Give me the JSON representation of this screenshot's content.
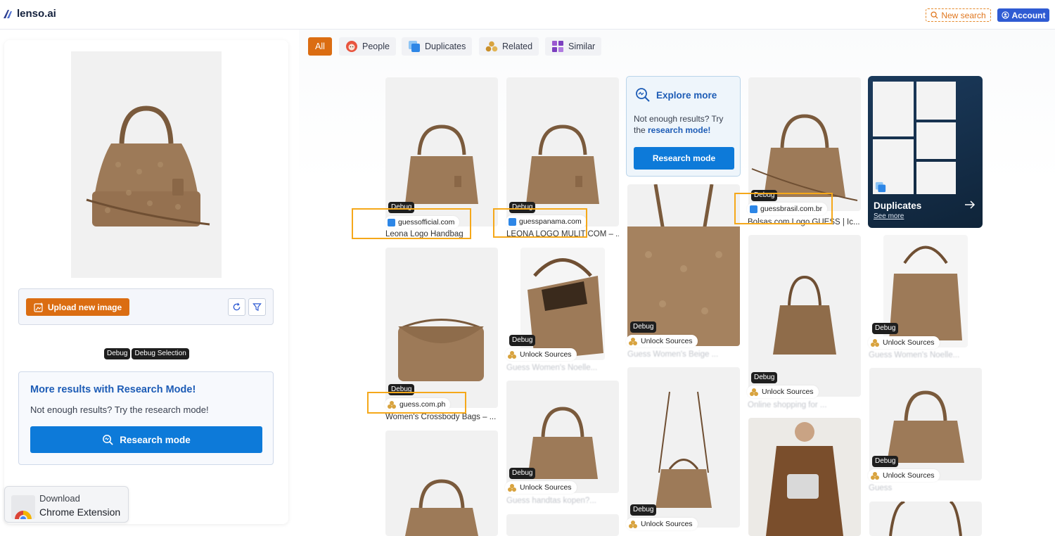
{
  "header": {
    "logo_text": "lenso.ai",
    "new_search_label": "New search",
    "account_label": "Account"
  },
  "left": {
    "upload_label": "Upload new image",
    "debug_labels": [
      "Debug",
      "Debug Selection"
    ],
    "research": {
      "title": "More results with Research Mode!",
      "subtitle": "Not enough results? Try the research mode!",
      "button_label": "Research mode"
    },
    "chrome": {
      "line1": "Download",
      "line2": "Chrome Extension"
    }
  },
  "tabs": [
    {
      "label": "All",
      "active": true
    },
    {
      "label": "People",
      "icon": "face-icon"
    },
    {
      "label": "Duplicates",
      "icon": "duplicates-icon"
    },
    {
      "label": "Related",
      "icon": "related-icon"
    },
    {
      "label": "Similar",
      "icon": "similar-icon"
    }
  ],
  "explore": {
    "title": "Explore more",
    "text_prefix": "Not enough results? Try the ",
    "text_link": "research mode!",
    "button_label": "Research mode"
  },
  "duplicates_card": {
    "title": "Duplicates",
    "see_more": "See more"
  },
  "debug_label": "Debug",
  "unlock_label": "Unlock Sources",
  "results": [
    {
      "source": "guessofficial.com",
      "title": "Leona Logo Handbag"
    },
    {
      "source": "guesspanama.com",
      "title": "LEONA LOGO MULIT COM – ..."
    },
    {
      "source": "guessbrasil.com.br",
      "title": "Bolsas com Logo GUESS | Íc..."
    },
    {
      "source": "guess.com.ph",
      "title": "Women's Crossbody Bags – ..."
    },
    {
      "title": "Guess Women's Noelle..."
    },
    {
      "title": "Guess Women's Beige ..."
    },
    {
      "title": "Online shopping for ..."
    },
    {
      "title": "Guess Women's Noelle..."
    },
    {
      "title": "Guess handtas kopen?..."
    },
    {
      "title": "Guess"
    }
  ],
  "colors": {
    "accent_orange": "#db6d12",
    "primary_blue": "#0d7ad9",
    "highlight": "#f5a81a"
  }
}
